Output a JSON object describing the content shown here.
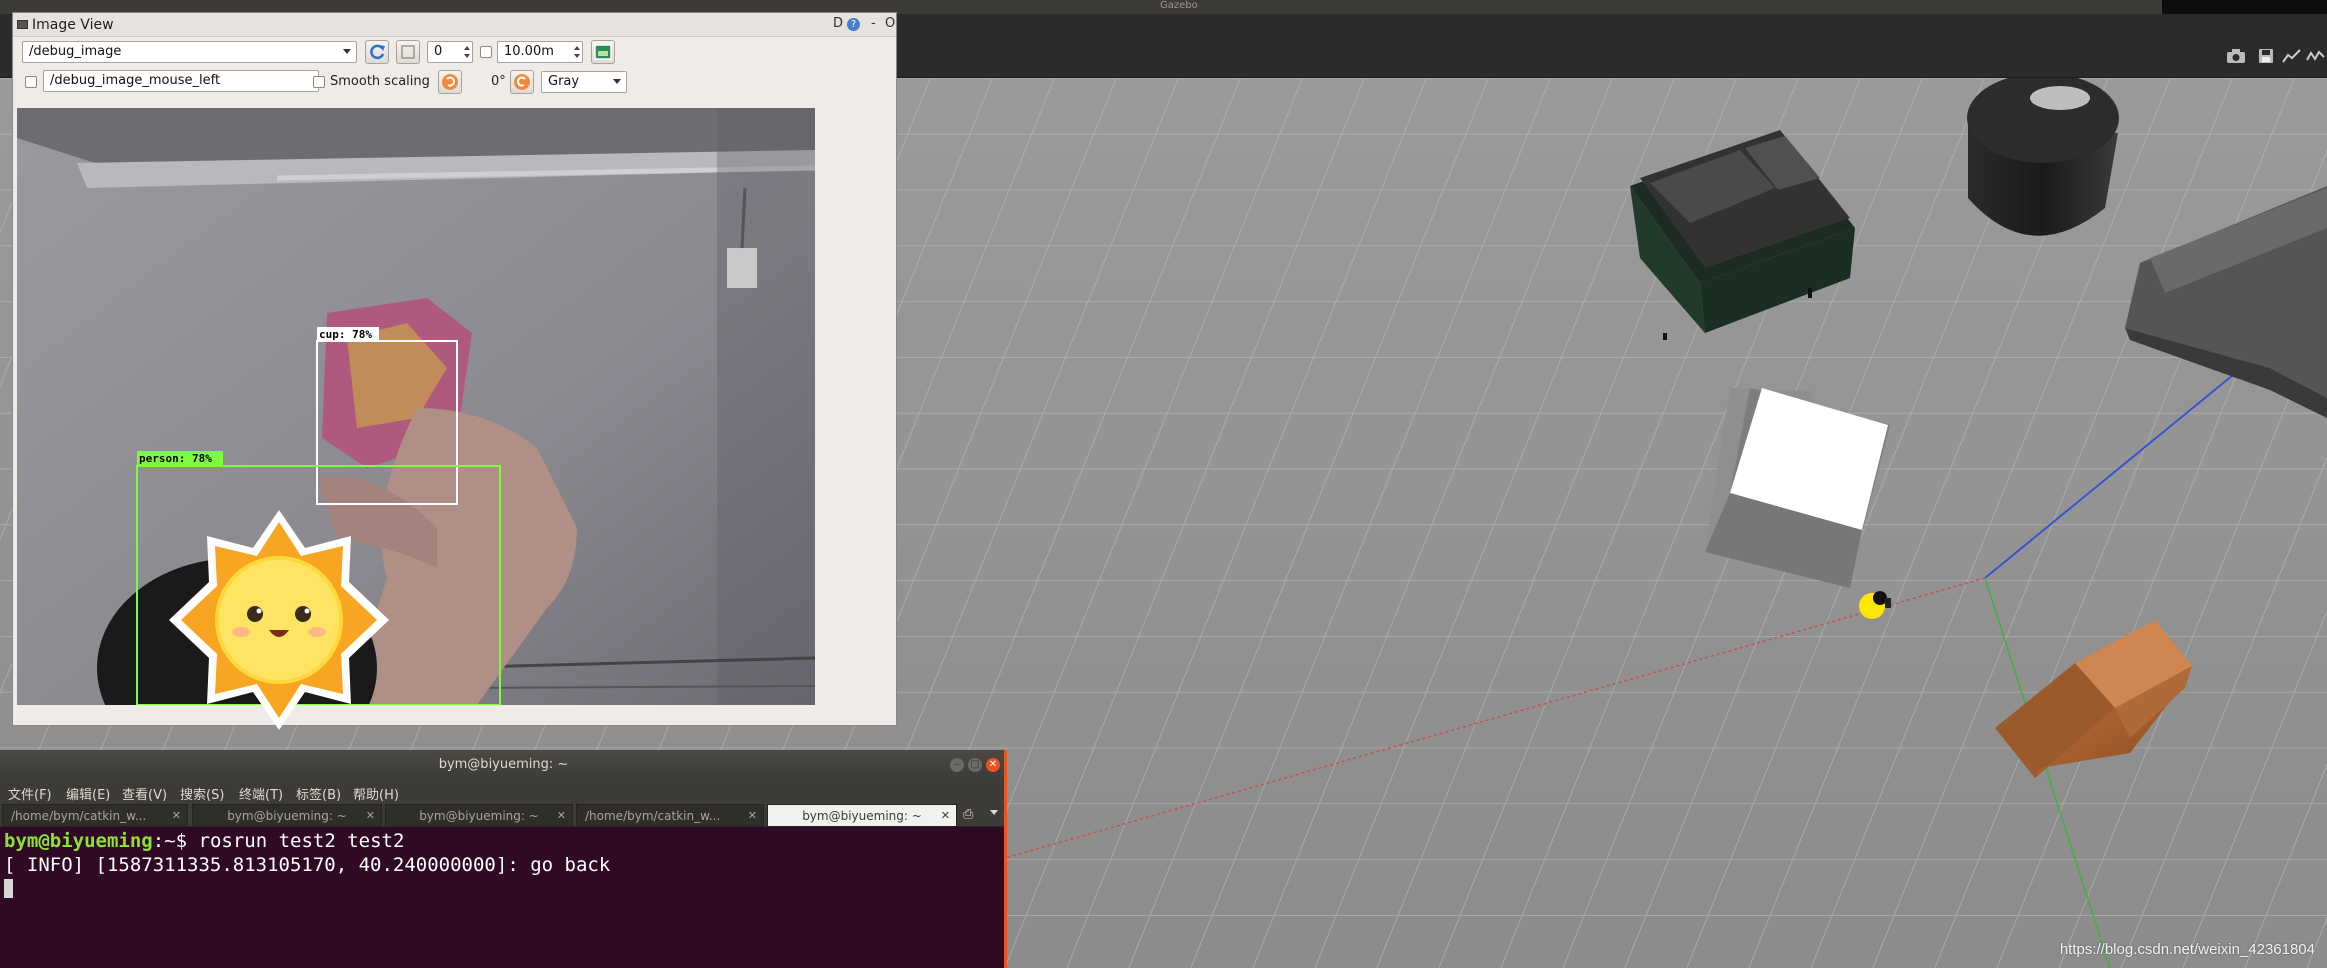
{
  "gazebo": {
    "top_title": "Gazebo",
    "toolbar_icons": [
      "camera-icon",
      "save-icon",
      "chart-icon",
      "plot-icon"
    ],
    "watermark": "https://blog.csdn.net/weixin_42361804"
  },
  "image_view": {
    "window_title": "Image View",
    "title_buttons": [
      "D",
      "?",
      "-",
      "O"
    ],
    "topic": "/debug_image",
    "spin_value": "0",
    "distance": "10.00m",
    "mouse_topic": "/debug_image_mouse_left",
    "smooth_scaling_label": "Smooth scaling",
    "rotation": "0°",
    "color_scheme": "Gray",
    "detections": [
      {
        "label": "cup: 78%",
        "color": "#ffffff"
      },
      {
        "label": "person: 78%",
        "color": "#7cfc3a"
      }
    ]
  },
  "terminal": {
    "title": "bym@biyueming: ~",
    "menu": [
      "文件(F)",
      "编辑(E)",
      "查看(V)",
      "搜索(S)",
      "终端(T)",
      "标签(B)",
      "帮助(H)"
    ],
    "tabs": [
      {
        "label": "/home/bym/catkin_w...",
        "active": false
      },
      {
        "label": "bym@biyueming: ~",
        "active": false
      },
      {
        "label": "bym@biyueming: ~",
        "active": false
      },
      {
        "label": "/home/bym/catkin_w...",
        "active": false
      },
      {
        "label": "bym@biyueming: ~",
        "active": true
      }
    ],
    "prompt_user": "bym@biyueming",
    "prompt_path": ":~",
    "prompt_symbol": "$ ",
    "command": "rosrun test2 test2",
    "output": "[ INFO] [1587311335.813105170, 40.240000000]: go back"
  }
}
